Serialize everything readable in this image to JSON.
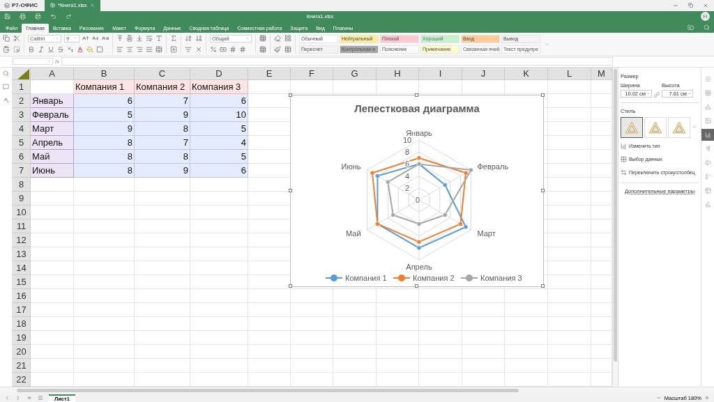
{
  "app": {
    "name": "Р7-ОФИС"
  },
  "doc_tab": {
    "title": "*Книга1.xlsx"
  },
  "title": "Книга1.xlsx",
  "user": {
    "initial": "Н"
  },
  "menu_tabs": [
    {
      "label": "Файл",
      "selected": false
    },
    {
      "label": "Главная",
      "selected": true
    },
    {
      "label": "Вставка",
      "selected": false
    },
    {
      "label": "Рисование",
      "selected": false
    },
    {
      "label": "Макет",
      "selected": false
    },
    {
      "label": "Формула",
      "selected": false
    },
    {
      "label": "Данные",
      "selected": false
    },
    {
      "label": "Сводная таблица",
      "selected": false
    },
    {
      "label": "Совместная работа",
      "selected": false
    },
    {
      "label": "Защита",
      "selected": false
    },
    {
      "label": "Вид",
      "selected": false
    },
    {
      "label": "Плагины",
      "selected": false
    }
  ],
  "toolbar": {
    "font": "Calibri",
    "size": "9",
    "number_format": "Общий",
    "cell_styles": [
      {
        "label": "Обычный",
        "color": "#ffffff"
      },
      {
        "label": "Нейтральный",
        "color": "#ffeb9c"
      },
      {
        "label": "Плохой",
        "color": "#ffc7ce"
      },
      {
        "label": "Хороший",
        "color": "#c6efce"
      },
      {
        "label": "Ввод",
        "color": "#ffcc99"
      },
      {
        "label": "Вывод",
        "color": "#f2f2f2"
      },
      {
        "label": "Пересчет",
        "color": "#f2f2f2"
      },
      {
        "label": "Контрольная я",
        "color": "#a5a5a5"
      },
      {
        "label": "Пояснение",
        "color": "#fbfbfb"
      },
      {
        "label": "Примечание",
        "color": "#ffffcc"
      },
      {
        "label": "Связанная ячей",
        "color": "#fefefe"
      },
      {
        "label": "Текст предупре",
        "color": "#fdfdfd"
      }
    ]
  },
  "formula_bar": {
    "fx": "fx"
  },
  "columns": [
    "A",
    "B",
    "C",
    "D",
    "E",
    "F",
    "G",
    "H",
    "I",
    "J",
    "K",
    "L",
    "M"
  ],
  "header_row": {
    "number": "1",
    "cells": [
      "Компания 1",
      "Компания 2",
      "Компания 3"
    ]
  },
  "data_rows": [
    {
      "number": "2",
      "cells": [
        "Январь",
        "6",
        "7",
        "6"
      ]
    },
    {
      "number": "3",
      "cells": [
        "Февраль",
        "5",
        "9",
        "10"
      ]
    },
    {
      "number": "4",
      "cells": [
        "Март",
        "9",
        "8",
        "5"
      ]
    },
    {
      "number": "5",
      "cells": [
        "Апрель",
        "8",
        "7",
        "4"
      ]
    },
    {
      "number": "6",
      "cells": [
        "Май",
        "8",
        "8",
        "5"
      ]
    },
    {
      "number": "7",
      "cells": [
        "Июнь",
        "8",
        "9",
        "6"
      ]
    }
  ],
  "empty_rows": [
    "8",
    "9",
    "10",
    "11",
    "12",
    "13",
    "14",
    "15",
    "16",
    "17",
    "18",
    "19",
    "20",
    "21",
    "22"
  ],
  "chart": {
    "title": "Лепестковая диаграмма",
    "axis_labels": [
      "Январь",
      "Февраль",
      "Март",
      "Апрель",
      "Май",
      "Июнь"
    ],
    "tick_labels": [
      "10",
      "8",
      "6",
      "4",
      "2",
      "0"
    ],
    "legend": [
      {
        "name": "Компания 1",
        "color": "#5b9bd5"
      },
      {
        "name": "Компания 2",
        "color": "#ed7d31"
      },
      {
        "name": "Компания 3",
        "color": "#a5a5a5"
      }
    ]
  },
  "panel": {
    "size_label": "Размер",
    "width": {
      "label": "Ширина",
      "value": "10.02 см"
    },
    "height": {
      "label": "Высота",
      "value": "7.61 см"
    },
    "style_label": "Стиль",
    "styles": [
      {
        "selected": true
      },
      {
        "selected": false
      },
      {
        "selected": false
      }
    ],
    "actions": [
      "Изменить тип",
      "Выбор данных",
      "Переключить строку/столбец"
    ],
    "more_link": "Дополнительные параметры"
  },
  "side_tabs": [
    {
      "selected": false
    },
    {
      "selected": false
    },
    {
      "selected": false
    },
    {
      "selected": false
    },
    {
      "selected": true
    },
    {
      "selected": false
    },
    {
      "selected": false
    },
    {
      "selected": false
    },
    {
      "selected": false
    },
    {
      "selected": false
    }
  ],
  "sheets": [
    {
      "label": "Лист1",
      "selected": true
    }
  ],
  "zoom": {
    "label": "Масштаб 180%"
  }
}
